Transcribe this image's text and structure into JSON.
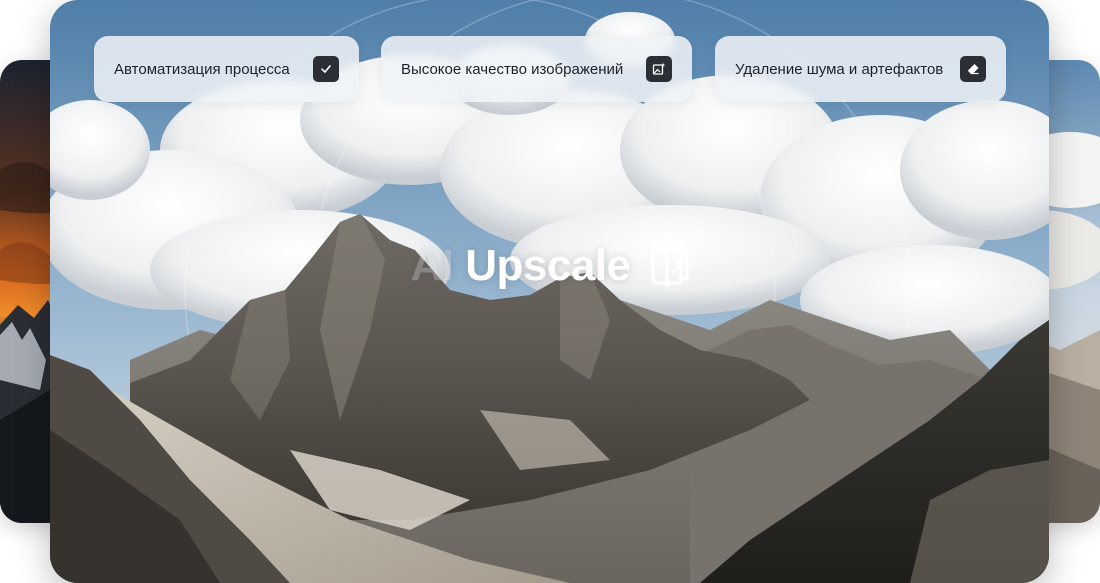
{
  "features": [
    {
      "label": "Автоматизация процесса",
      "icon": "checkmark-icon"
    },
    {
      "label": "Высокое качество изображений",
      "icon": "image-sparkle-icon"
    },
    {
      "label": "Удаление шума и артефактов",
      "icon": "eraser-icon"
    }
  ],
  "brand": {
    "ai": "AI",
    "name": "Upscale",
    "icon": "upscale-logo-icon"
  },
  "colors": {
    "pill_background": "#f0f3f7",
    "icon_background": "#2b2f35",
    "text": "#1d2229",
    "sky": "#5b86ad"
  }
}
